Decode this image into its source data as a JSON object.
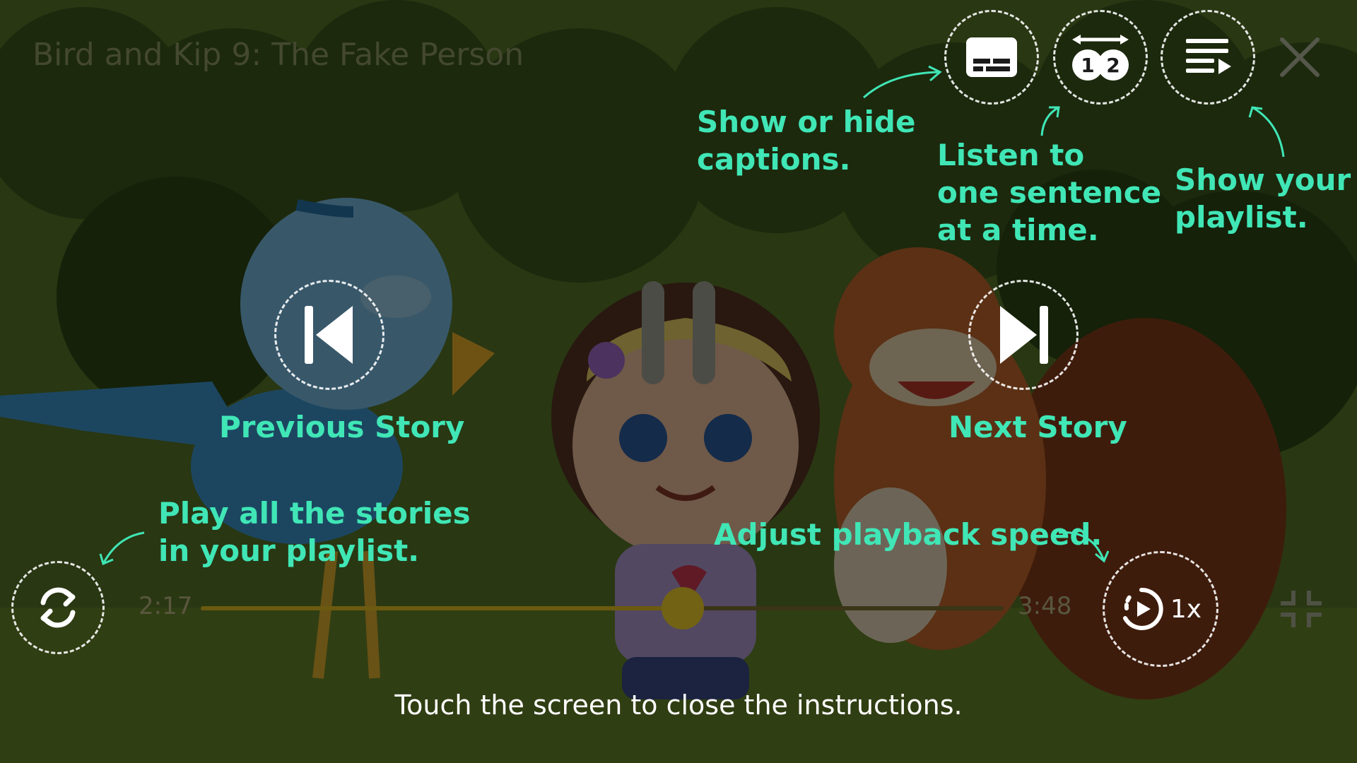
{
  "video": {
    "title": "Bird and Kip 9: The Fake Person"
  },
  "controls": {
    "captions_icon": "captions-icon",
    "sentence_icon": "one-sentence-icon",
    "playlist_icon": "playlist-icon",
    "close_icon": "close-icon",
    "previous_icon": "skip-previous-icon",
    "next_icon": "skip-next-icon",
    "pause_icon": "pause-icon",
    "repeat_icon": "repeat-all-icon",
    "speed_icon": "playback-speed-icon",
    "fullscreen_icon": "exit-fullscreen-icon",
    "speed_label": "1x"
  },
  "progress": {
    "elapsed": "2:17",
    "total": "3:48",
    "fraction": 0.6
  },
  "instructions": {
    "captions": [
      "Show or hide",
      "captions."
    ],
    "sentence": [
      "Listen to",
      "one sentence",
      "at a time."
    ],
    "playlist": [
      "Show your",
      "playlist."
    ],
    "previous": "Previous Story",
    "next": "Next Story",
    "play_all": [
      "Play all the stories",
      "in your playlist."
    ],
    "speed": "Adjust playback speed.",
    "close_hint": "Touch the screen to close the instructions."
  },
  "colors": {
    "accent": "#40e6b6",
    "ring": "#ffffff",
    "progress_knob": "#726214"
  }
}
